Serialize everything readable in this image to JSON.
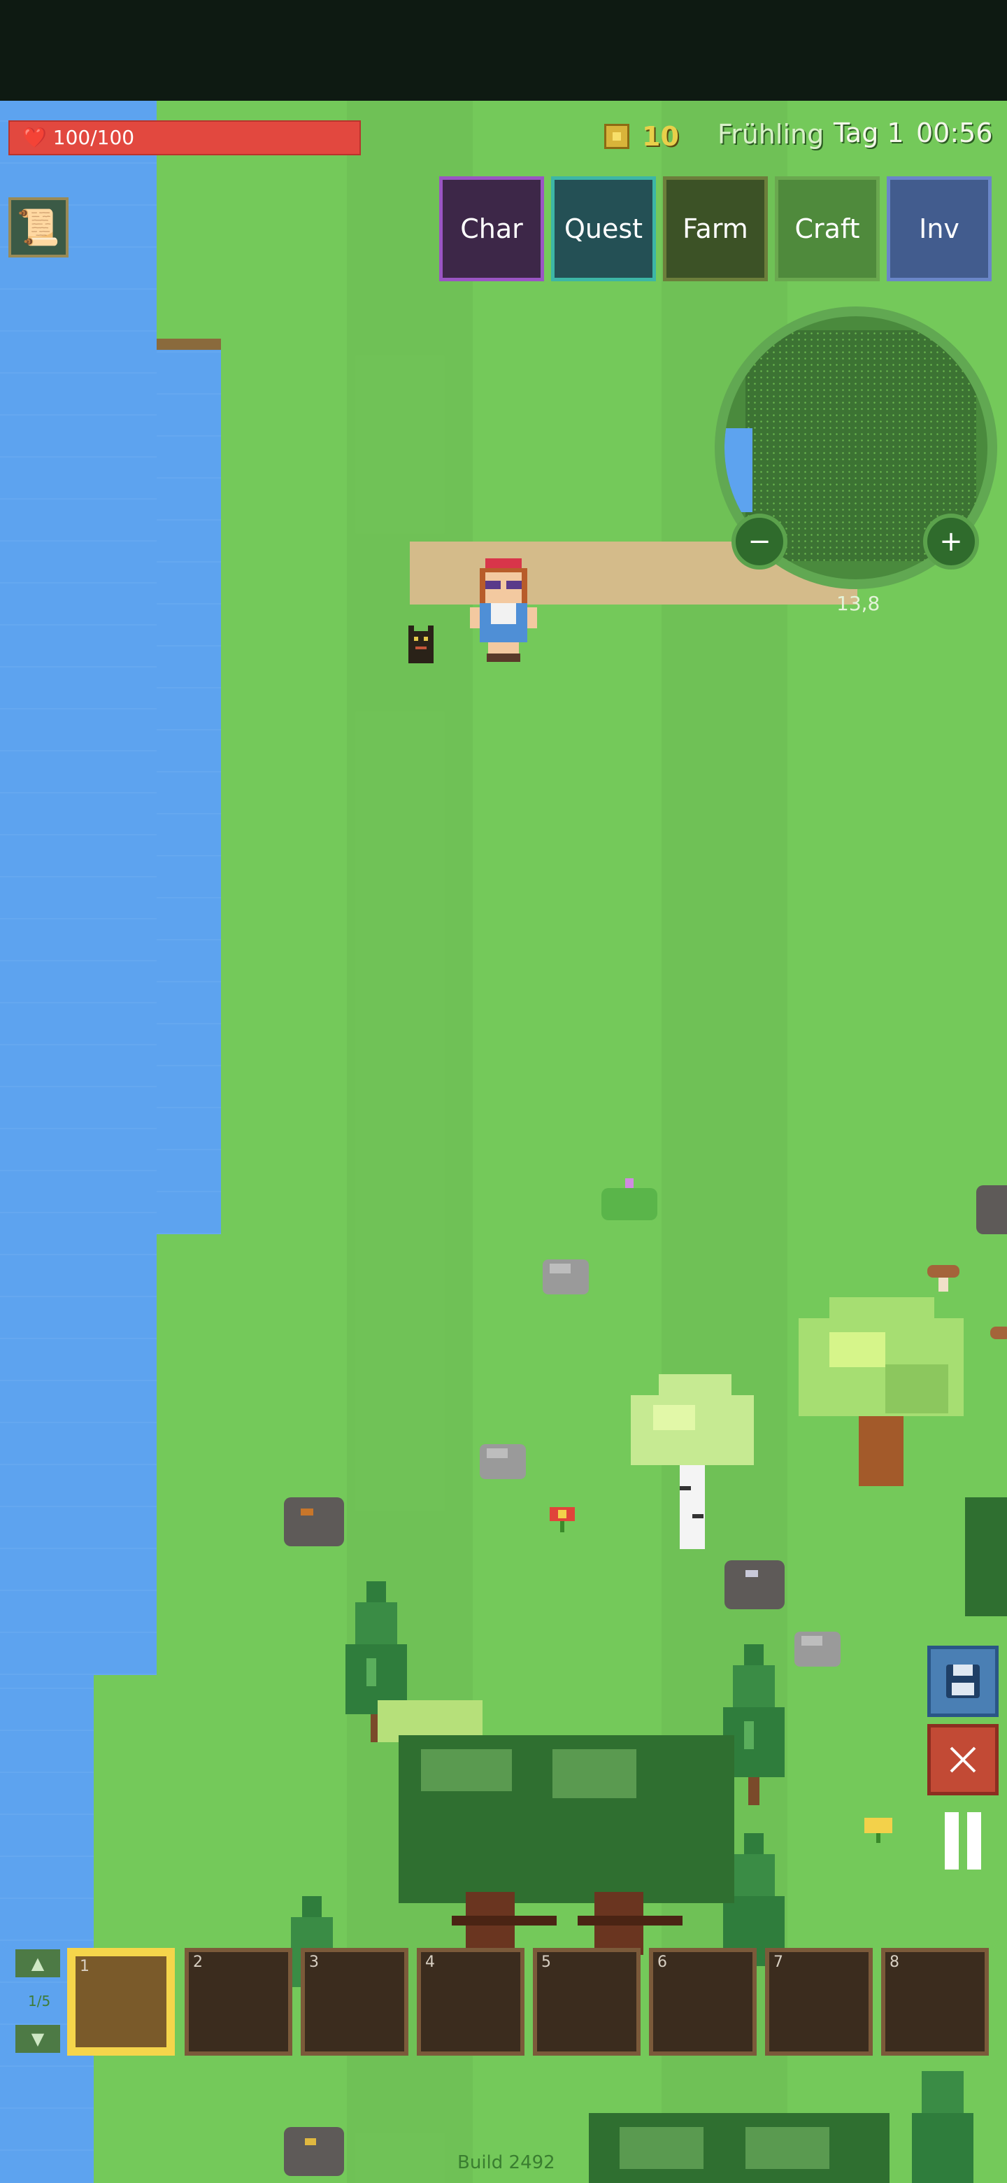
{
  "hud": {
    "health_text": "100/100",
    "coins": "10",
    "season": "Frühling",
    "day": "Tag 1",
    "time": "00:56"
  },
  "menu": [
    {
      "label": "Char",
      "bg": "#3d2748",
      "border": "#9a55c3"
    },
    {
      "label": "Quest",
      "bg": "#245055",
      "border": "#3db6a6"
    },
    {
      "label": "Farm",
      "bg": "#3c5226",
      "border": "#6c7e3b"
    },
    {
      "label": "Craft",
      "bg": "#4f8a3c",
      "border": "#6aa84f"
    },
    {
      "label": "Inv",
      "bg": "#425c8e",
      "border": "#6a86c8"
    }
  ],
  "minimap": {
    "zoom_out": "−",
    "zoom_in": "+",
    "coords": "13,8"
  },
  "hotbar": {
    "up": "▲",
    "down": "▼",
    "page": "1/5",
    "slots": [
      "1",
      "2",
      "3",
      "4",
      "5",
      "6",
      "7",
      "8"
    ],
    "selected": 1
  },
  "footer": {
    "build": "Build 2492"
  },
  "colors": {
    "grass": "#74c95a",
    "water": "#5da3ef",
    "health": "#e2483f",
    "hotbar_selected": "#f5d54b"
  }
}
